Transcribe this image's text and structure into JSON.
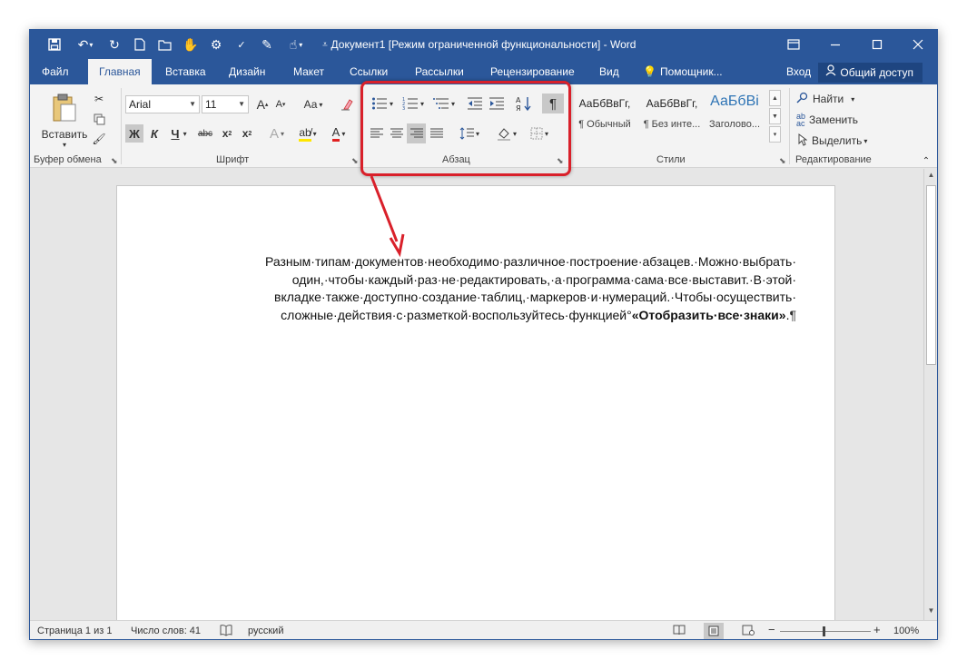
{
  "window": {
    "title": "Документ1 [Режим ограниченной функциональности] - Word"
  },
  "tabs": [
    "Файл",
    "Главная",
    "Вставка",
    "Дизайн",
    "Макет",
    "Ссылки",
    "Рассылки",
    "Рецензирование",
    "Вид",
    "Помощник..."
  ],
  "tab_active": "Главная",
  "account": {
    "login": "Вход",
    "share": "Общий доступ"
  },
  "clipboard": {
    "paste_label": "Вставить",
    "group_label": "Буфер обмена"
  },
  "font": {
    "name": "Arial",
    "size": "11",
    "case_label": "Аа",
    "bold": "Ж",
    "italic": "К",
    "underline": "Ч",
    "strike": "abc",
    "group_label": "Шрифт"
  },
  "paragraph": {
    "group_label": "Абзац",
    "show_marks_glyph": "¶"
  },
  "styles": {
    "group_label": "Стили",
    "items": [
      {
        "sample": "АаБбВвГг,",
        "name": "¶ Обычный"
      },
      {
        "sample": "АаБбВвГг,",
        "name": "¶ Без инте..."
      },
      {
        "sample": "АаБбВі",
        "name": "Заголово..."
      }
    ]
  },
  "editing": {
    "find": "Найти",
    "replace": "Заменить",
    "select": "Выделить",
    "group_label": "Редактирование"
  },
  "document": {
    "lines": [
      "Разным·типам·документов·необходимо·различное·построение·абзацев.·Можно·выбрать·",
      "один,·чтобы·каждый·раз·не·редактировать,·а·программа·сама·все·выставит.·В·этой·",
      "вкладке·также·доступно·создание·таблиц,·маркеров·и·нумераций.·Чтобы·осуществить·"
    ],
    "last_line_prefix": "сложные·действия·с·разметкой·воспользуйтесь·функцией°",
    "last_line_bold": "«Отобразить·все·знаки»",
    "last_line_suffix": ".",
    "pilcrow": "¶"
  },
  "status": {
    "page": "Страница 1 из 1",
    "words": "Число слов: 41",
    "language": "русский",
    "zoom": "100%"
  }
}
